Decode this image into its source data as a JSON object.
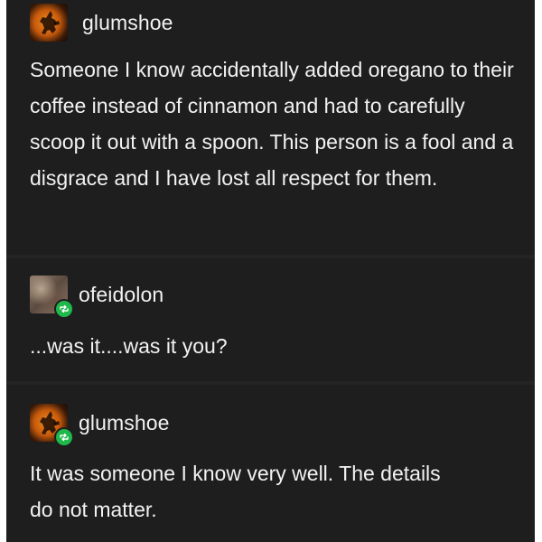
{
  "posts": [
    {
      "username": "glumshoe",
      "avatar": "dog-silhouette-avatar",
      "reblog": false,
      "text": "Someone I know accidentally added oregano to their coffee instead of cinnamon and had to carefully scoop it out with a spoon. This person is a fool and a disgrace and I have lost all respect for them."
    },
    {
      "username": "ofeidolon",
      "avatar": "photo-avatar",
      "reblog": true,
      "text": "...was it....was it you?"
    },
    {
      "username": "glumshoe",
      "avatar": "dog-silhouette-avatar",
      "reblog": true,
      "text": "It was someone I know very well. The details do not matter."
    }
  ],
  "colors": {
    "background": "#1e1e1e",
    "divider": "#242424",
    "text": "#f2f2f2",
    "reblog_badge": "#1fb84a"
  }
}
